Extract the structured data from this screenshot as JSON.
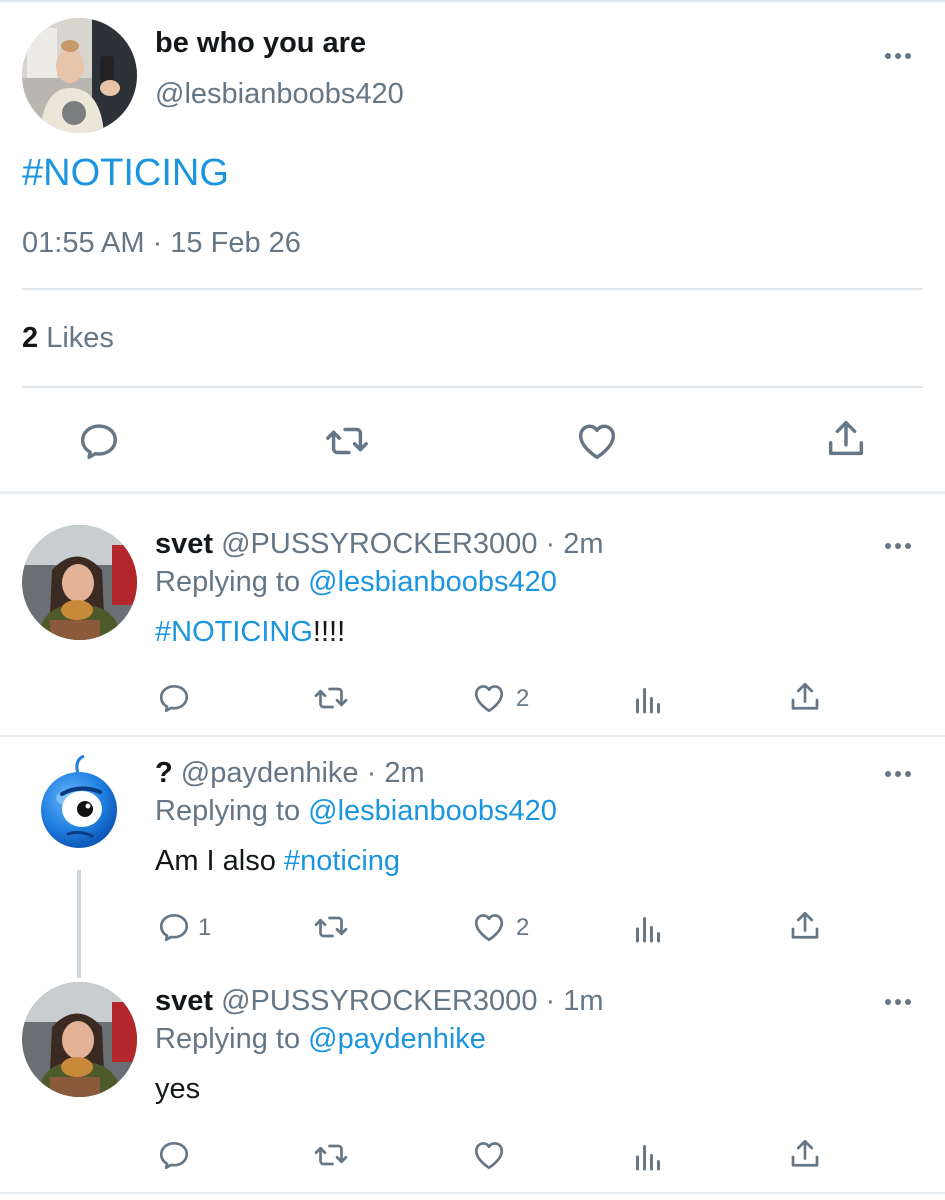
{
  "main_tweet": {
    "display_name": "be who you are",
    "handle": "@lesbianboobs420",
    "text": "#NOTICING",
    "timestamp": "01:55 AM · 15 Feb 26",
    "likes_count": "2",
    "likes_label": " Likes",
    "actions": [
      "reply-icon",
      "retweet-icon",
      "like-icon",
      "share-icon"
    ]
  },
  "replies": [
    {
      "display_name": "svet",
      "meta": " @PUSSYROCKER3000 · 2m",
      "replying_prefix": "Replying to ",
      "replying_to": "@lesbianboobs420",
      "text_hashtag": "#NOTICING",
      "text_rest": "!!!!",
      "reply_count": "",
      "like_count": "2"
    },
    {
      "display_name": "?",
      "meta": " @paydenhike · 2m",
      "replying_prefix": "Replying to ",
      "replying_to": "@lesbianboobs420",
      "text_prefix": "Am I also ",
      "text_hashtag": "#noticing",
      "reply_count": "1",
      "like_count": "2"
    },
    {
      "display_name": "svet",
      "meta": " @PUSSYROCKER3000 · 1m",
      "replying_prefix": "Replying to ",
      "replying_to": "@paydenhike",
      "text": "yes",
      "reply_count": "",
      "like_count": ""
    }
  ],
  "colors": {
    "link": "#1b95e0",
    "secondary": "#657786",
    "primary": "#14171a",
    "divider": "#e1e8ed"
  }
}
